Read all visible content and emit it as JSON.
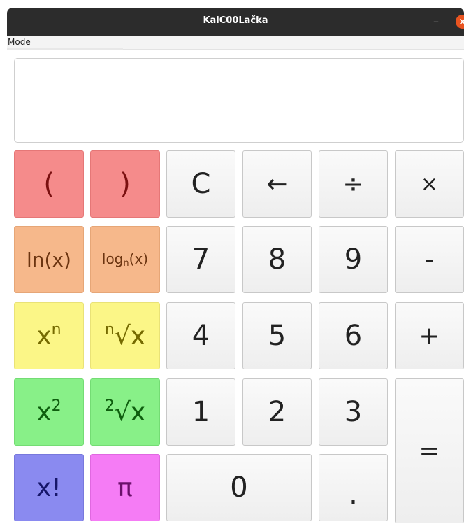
{
  "window": {
    "title": "KalC00Lačka",
    "minimize_glyph": "–",
    "close_icon": "close-icon"
  },
  "menu": {
    "mode_label": "Mode"
  },
  "display": {
    "value": ""
  },
  "buttons": {
    "paren_open": "(",
    "paren_close": ")",
    "clear": "C",
    "backspace": "←",
    "divide": "÷",
    "multiply": "×",
    "ln": "ln(x)",
    "log_base": "log",
    "log_sub": "n",
    "log_arg": "(x)",
    "seven": "7",
    "eight": "8",
    "nine": "9",
    "minus": "-",
    "power_base": "x",
    "power_exp": "n",
    "nroot_index": "n",
    "nroot_body": "√x",
    "four": "4",
    "five": "5",
    "six": "6",
    "plus": "+",
    "square_base": "x",
    "square_exp": "2",
    "sqrt_index": "2",
    "sqrt_body": "√x",
    "one": "1",
    "two": "2",
    "three": "3",
    "equals": "=",
    "factorial": "x!",
    "pi": "π",
    "zero": "0",
    "decimal": "."
  },
  "colors": {
    "parentheses": "#f58b8b",
    "logarithms": "#f6b88b",
    "powers": "#fbf687",
    "squares": "#88f088",
    "factorial": "#8a8af0",
    "pi": "#f57cf5",
    "titlebar": "#2c2c2c",
    "close_button": "#e95420"
  }
}
